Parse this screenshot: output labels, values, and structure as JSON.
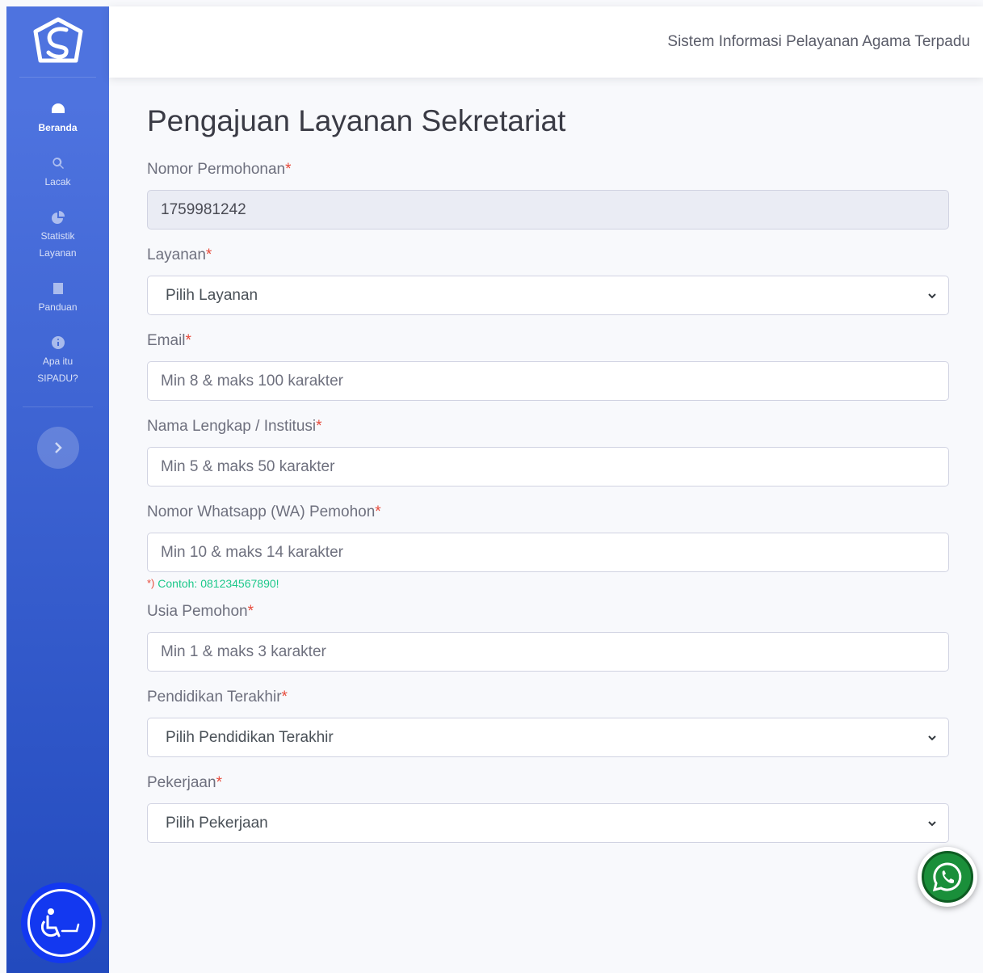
{
  "header": {
    "title": "Sistem Informasi Pelayanan Agama Terpadu"
  },
  "sidebar": {
    "items": [
      {
        "label": "Beranda",
        "icon": "dashboard-gauge-icon",
        "active": true
      },
      {
        "label": "Lacak",
        "icon": "search-icon",
        "active": false
      },
      {
        "label": "Statistik Layanan",
        "icon": "pie-chart-icon",
        "active": false
      },
      {
        "label": "Panduan",
        "icon": "book-icon",
        "active": false
      },
      {
        "label": "Apa itu SIPADU?",
        "icon": "info-circle-icon",
        "active": false
      }
    ],
    "toggle_icon": "chevron-right-icon",
    "accessibility_icon": "accessibility-icon"
  },
  "main": {
    "page_title": "Pengajuan Layanan Sekretariat",
    "required_mark": "*",
    "fields": {
      "nomor_permohonan": {
        "label": "Nomor Permohonan",
        "value": "1759981242"
      },
      "layanan": {
        "label": "Layanan",
        "selected": "Pilih Layanan"
      },
      "email": {
        "label": "Email",
        "placeholder": "Min 8 & maks 100 karakter"
      },
      "nama": {
        "label": "Nama Lengkap / Institusi",
        "placeholder": "Min 5 & maks 50 karakter"
      },
      "whatsapp": {
        "label": "Nomor Whatsapp (WA) Pemohon",
        "placeholder": "Min 10 & maks 14 karakter",
        "hint_mark": "*)",
        "hint": "Contoh: 081234567890!"
      },
      "usia": {
        "label": "Usia Pemohon",
        "placeholder": "Min 1 & maks 3 karakter"
      },
      "pendidikan": {
        "label": "Pendidikan Terakhir",
        "selected": "Pilih Pendidikan Terakhir"
      },
      "pekerjaan": {
        "label": "Pekerjaan",
        "selected": "Pilih Pekerjaan"
      }
    }
  },
  "floating": {
    "whatsapp_icon": "whatsapp-icon"
  },
  "colors": {
    "sidebar_top": "#4e73df",
    "sidebar_bottom": "#224abe",
    "required": "#e74a3b",
    "hint": "#1cc88a",
    "whatsapp": "#1a8f3a"
  }
}
